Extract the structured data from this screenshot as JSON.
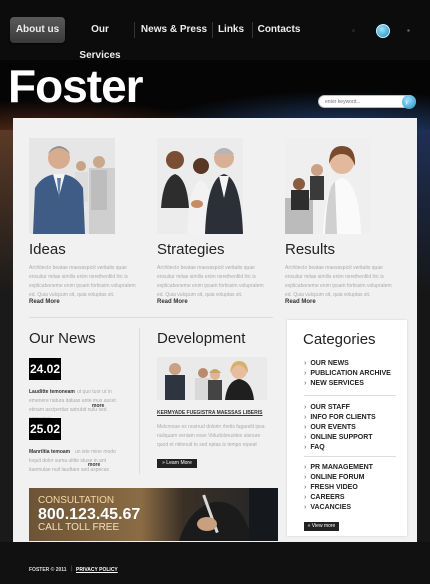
{
  "nav": {
    "items": [
      {
        "label": "About us",
        "active": true
      },
      {
        "label": "Our Services",
        "active": false
      },
      {
        "label": "News & Press",
        "active": false
      },
      {
        "label": "Links",
        "active": false
      },
      {
        "label": "Contacts",
        "active": false
      }
    ]
  },
  "hero": {
    "logo": "Foster",
    "search_placeholder": "enter keyword..."
  },
  "columns": [
    {
      "title": "Ideas",
      "text": "Architecto beatae maesaspicit veritatis quae ensuitur mitae similis enim nerethentlid hic is explicaboneme enim ipsam fortissim volupratem ed. Quia vulcpum sit, quia voluptas sit.",
      "readmore": "Read More"
    },
    {
      "title": "Strategies",
      "text": "Architecto beatae maesaspicit veritatis quae ensuitur mitae similis enim nerethentlid hic is explicaboneme enim ipsam fortissim volupratem ed. Quia vulcpum sit, quia voluptas sit.",
      "readmore": "Read More"
    },
    {
      "title": "Results",
      "text": "Architecto beatae maesaspicit veritatis quae ensuitur mitae similis enim nerethentlid hic is explicaboneme enim ipsam fortissim volupratem ed. Quia vulcpum sit, quia voluptas sit.",
      "readmore": "Read More"
    }
  ],
  "news": {
    "title": "Our News",
    "items": [
      {
        "date": "24.02",
        "headline": "Lauditte temoneam",
        "text": "ut quo tuor ut in emenere natura itatuas ante mus ascet etinam ascipertiar astrubit nulu sed aggravica",
        "more": "more"
      },
      {
        "date": "25.02",
        "headline": "Manriltia temoam",
        "text": "un iste mine modo loquit dolor suma ultite stuse in ant itaemulae nuit laudtare sed aspecas",
        "more": "more"
      }
    ]
  },
  "development": {
    "title": "Development",
    "link": "KERMYADE FUEGISTRA MAESSAS LIBERIS",
    "text": "Melcmoue ex nostrud dolorin rhetis fugarelit ipsa nuliquam veniam esse Vidudolorusites utsnure quod et nitinnuit to sed eptas is tempo repeat",
    "button": "» Learn More"
  },
  "categories": {
    "title": "Categories",
    "groups": [
      [
        "OUR NEWS",
        "PUBLICATION ARCHIVE",
        "NEW SERVICES"
      ],
      [
        "OUR STAFF",
        "INFO FOR CLIENTS",
        "OUR EVENTS",
        "ONLINE SUPPORT",
        "FAQ"
      ],
      [
        "PR MANAGEMENT",
        "ONLINE FORUM",
        "FRESH VIDEO",
        "CAREERS",
        "VACANCIES"
      ]
    ],
    "button": "» View more"
  },
  "consult": {
    "label": "CONSULTATION",
    "phone": "800.123.45.67",
    "toll": "CALL TOLL FREE"
  },
  "footer": {
    "copyright": "FOSTER © 2011",
    "separator": "|",
    "privacy": "PRIVACY POLICY"
  }
}
